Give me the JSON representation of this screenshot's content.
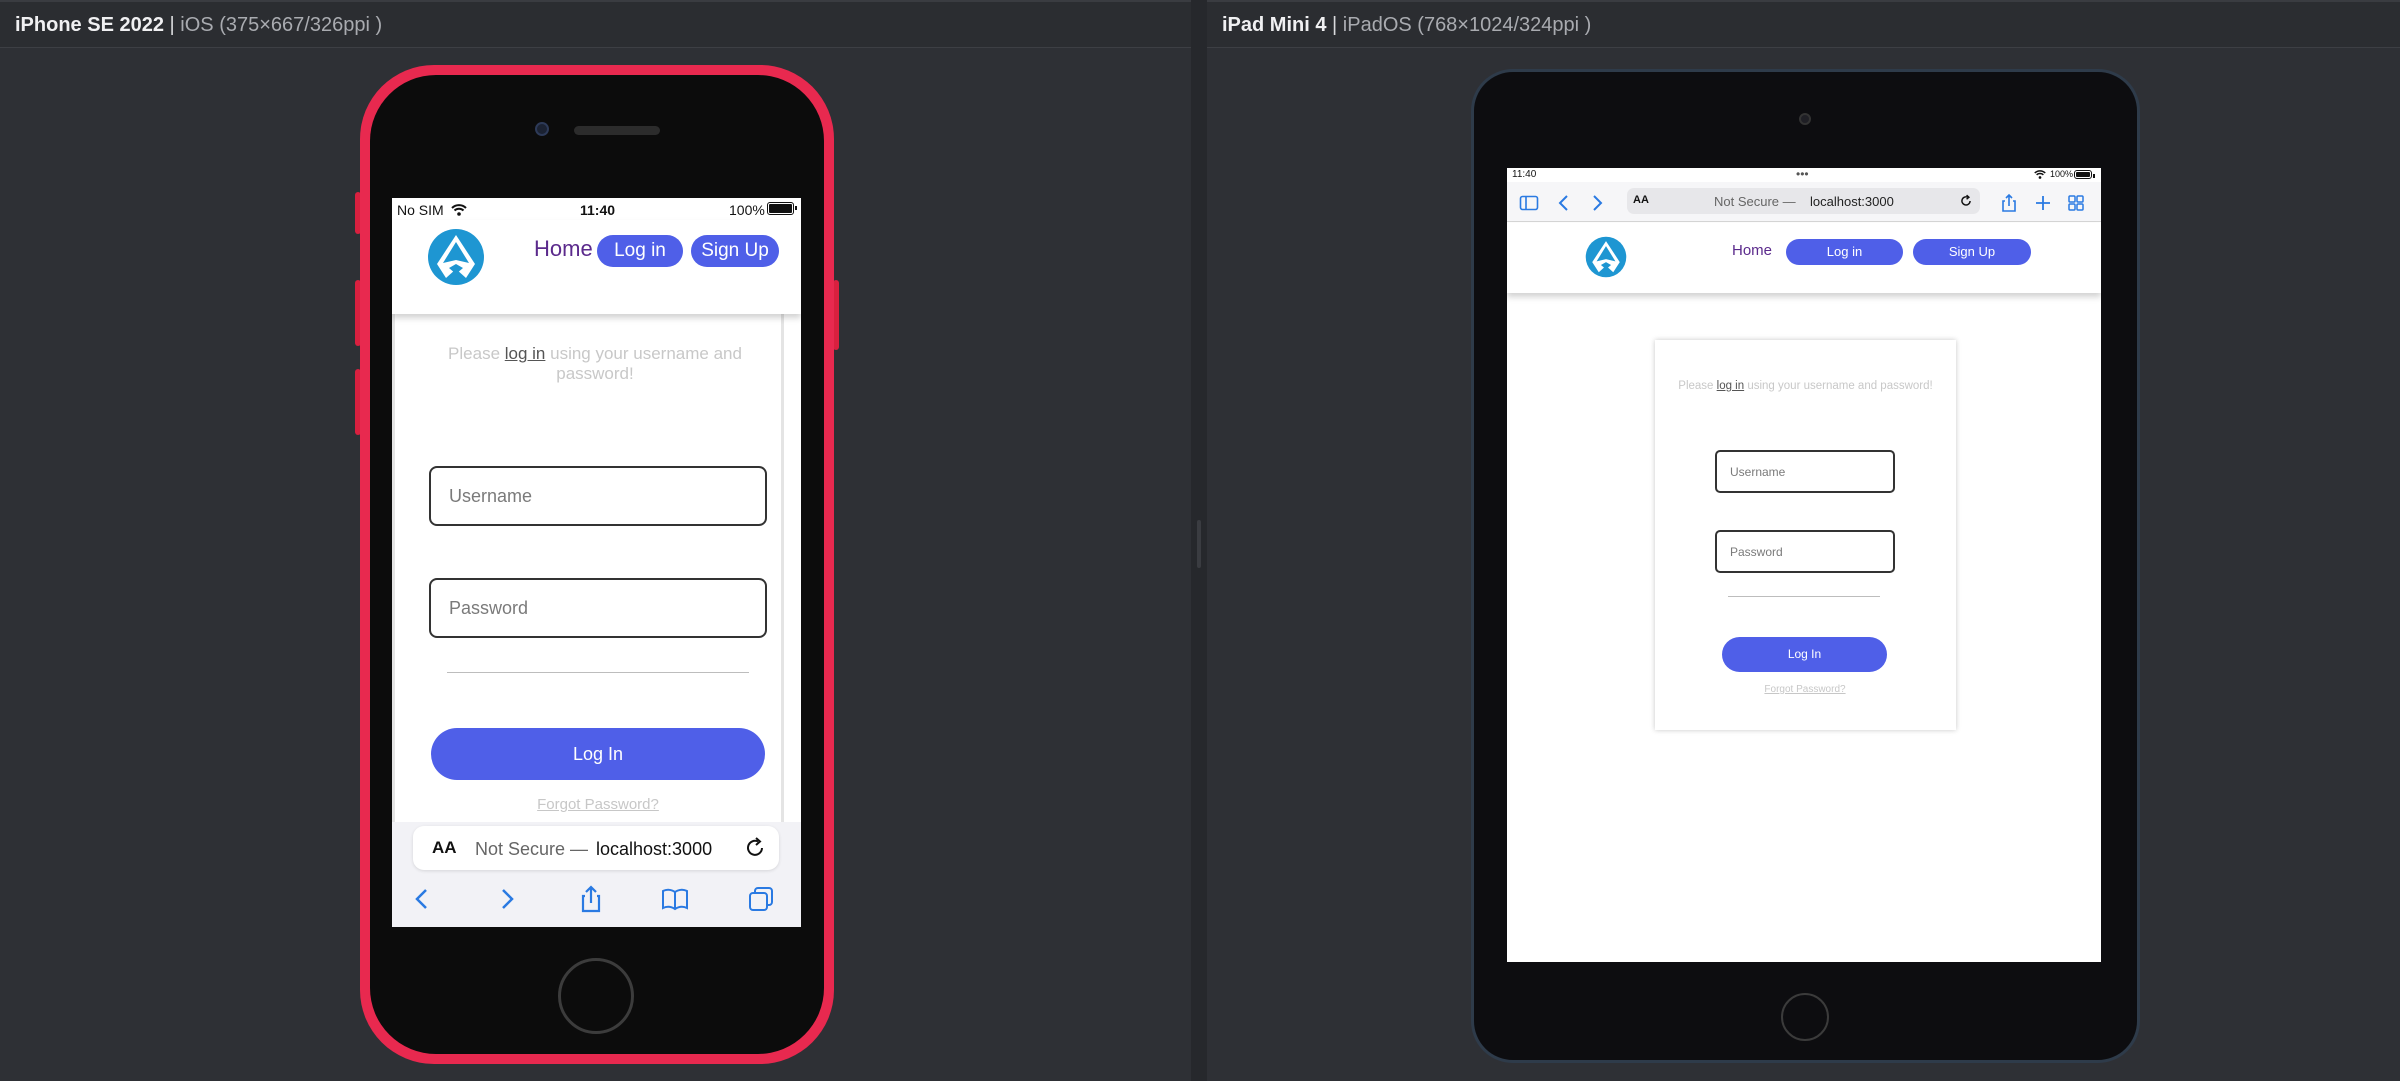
{
  "left_panel": {
    "device_name": "iPhone SE 2022",
    "separator": "|",
    "spec": "iOS (375×667/326ppi )"
  },
  "right_panel": {
    "device_name": "iPad Mini 4",
    "separator": "|",
    "spec": "iPadOS (768×1024/324ppi )"
  },
  "iphone": {
    "status": {
      "carrier": "No SIM",
      "time": "11:40",
      "battery": "100%"
    },
    "nav": {
      "home": "Home",
      "login": "Log in",
      "signup": "Sign Up"
    },
    "prompt": {
      "before": "Please ",
      "link": "log in",
      "after": " using your username and password!"
    },
    "username_placeholder": "Username",
    "password_placeholder": "Password",
    "login_button": "Log In",
    "forgot": "Forgot Password?",
    "safari": {
      "aa": "AA",
      "not_secure": "Not Secure —",
      "host": "localhost:3000"
    }
  },
  "ipad": {
    "status": {
      "time": "11:40",
      "dots": "•••",
      "battery": "100%"
    },
    "safari": {
      "aa": "AA",
      "not_secure": "Not Secure —",
      "host": "localhost:3000"
    },
    "nav": {
      "home": "Home",
      "login": "Log in",
      "signup": "Sign Up"
    },
    "prompt": {
      "before": "Please ",
      "link": "log in",
      "after": " using your username and password!"
    },
    "username_placeholder": "Username",
    "password_placeholder": "Password",
    "login_button": "Log In",
    "forgot": "Forgot Password?"
  },
  "colors": {
    "accent": "#4f5fe8",
    "nav_home": "#5b2a8c",
    "iphone_frame": "#e8294f",
    "logo": "#1e96d2",
    "ios_blue": "#2a7ae2"
  }
}
